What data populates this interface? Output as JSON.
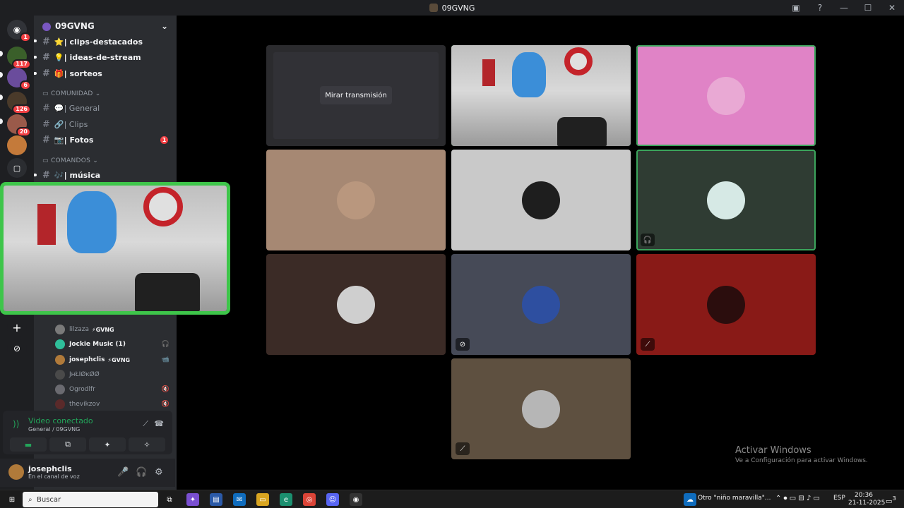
{
  "window": {
    "title": "09GVNG",
    "controls": [
      "notification-icon",
      "help-icon",
      "minimize",
      "maximize",
      "close"
    ]
  },
  "guilds": [
    {
      "name": "discord-home",
      "badge": "1"
    },
    {
      "name": "server-weed",
      "badge": "117"
    },
    {
      "name": "server-girl",
      "badge": "6"
    },
    {
      "name": "server-clash",
      "badge": "126"
    },
    {
      "name": "server-avatar-a",
      "badge": "20"
    },
    {
      "name": "server-avatar-b",
      "badge": ""
    },
    {
      "name": "server-twitch",
      "badge": ""
    }
  ],
  "server": {
    "name": "09GVNG"
  },
  "channels": [
    {
      "icon": "⭐",
      "label": "| clips-destacados",
      "style": "bold"
    },
    {
      "icon": "💡",
      "label": "| ideas-de-stream",
      "style": "bold"
    },
    {
      "icon": "🎁",
      "label": "| sorteos",
      "style": "bold"
    },
    {
      "icon": "💬",
      "label": "| General",
      "style": "muted"
    },
    {
      "icon": "🔗",
      "label": "| Clips",
      "style": "muted"
    },
    {
      "icon": "📷",
      "label": "| Fotos",
      "style": "bold",
      "badge": "1"
    },
    {
      "icon": "🎶",
      "label": "| música",
      "style": "bold"
    }
  ],
  "categories": {
    "comunidad": "COMUNIDAD",
    "comandos": "COMANDOS"
  },
  "voice_members": [
    {
      "name": "lilzaza",
      "tag": "⚡GVNG",
      "style": "muted",
      "right": ""
    },
    {
      "name": "Jockie Music (1)",
      "tag": "",
      "style": "bold",
      "right": "🎧"
    },
    {
      "name": "josephclis",
      "tag": "⚡GVNG",
      "style": "bold",
      "right": "📹"
    },
    {
      "name": "JнŁIØĸØØ",
      "tag": "",
      "style": "muted",
      "right": ""
    },
    {
      "name": "Ogrodlfr",
      "tag": "",
      "style": "muted",
      "right": "🔇"
    },
    {
      "name": "thevikzov",
      "tag": "",
      "style": "muted",
      "right": "🔇"
    }
  ],
  "voice_panel": {
    "status": "Video conectado",
    "channel": "General / 09GVNG"
  },
  "user_panel": {
    "name": "josephclis",
    "status": "En el canal de voz"
  },
  "stage": {
    "watch_label": "Mirar transmisión"
  },
  "tiles": [
    {
      "bg": "#2b2b2e",
      "kind": "stream"
    },
    {
      "bg": "#cfcfcf",
      "kind": "camera",
      "speaking": true
    },
    {
      "bg": "#e083c6",
      "kind": "avatar",
      "avatar": "#e9a9d4",
      "speaking": false
    },
    {
      "bg": "#a68873",
      "kind": "avatar",
      "avatar": "#b9977e"
    },
    {
      "bg": "#c9c9c9",
      "kind": "avatar",
      "avatar": "#1e1e1e"
    },
    {
      "bg": "#2f3c33",
      "kind": "avatar",
      "avatar": "#d6e9e5",
      "speaking": true,
      "tag": "🎧"
    },
    {
      "bg": "#3b2b26",
      "kind": "avatar",
      "avatar": "#cfcfcf"
    },
    {
      "bg": "#464a57",
      "kind": "avatar",
      "avatar": "#2e4fa0",
      "tag": "🔇"
    },
    {
      "bg": "#891a17",
      "kind": "avatar",
      "avatar": "#2b0d0d",
      "tag": "🚫"
    },
    {
      "bg": "#5e5040",
      "kind": "avatar",
      "avatar": "#b6b6b6",
      "tag": "🚫"
    }
  ],
  "watermark": {
    "line1": "Activar Windows",
    "line2": "Ve a Configuración para activar Windows."
  },
  "taskbar": {
    "search": "Buscar",
    "news": "Otro \"niño maravilla\"...",
    "lang": "ESP",
    "time": "20:36",
    "date": "21-11-2025",
    "notifications": "3"
  }
}
